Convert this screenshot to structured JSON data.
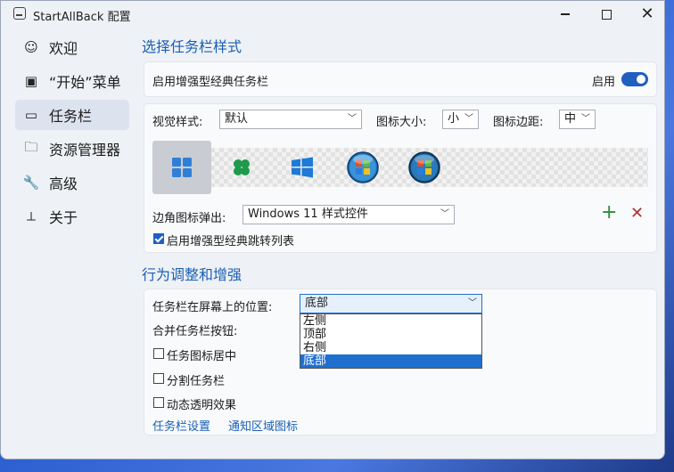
{
  "window": {
    "title": "StartAllBack 配置"
  },
  "sidebar": {
    "items": [
      {
        "label": "欢迎",
        "icon": "smile-icon"
      },
      {
        "label": "“开始”菜单",
        "icon": "start-menu-icon"
      },
      {
        "label": "任务栏",
        "icon": "taskbar-icon",
        "selected": true
      },
      {
        "label": "资源管理器",
        "icon": "folder-icon"
      },
      {
        "label": "高级",
        "icon": "wrench-icon"
      },
      {
        "label": "关于",
        "icon": "info-icon"
      }
    ]
  },
  "taskbar_style": {
    "heading": "选择任务栏样式",
    "enhanced_label": "启用增强型经典任务栏",
    "enable_label": "启用",
    "enabled": true,
    "visual_style_label": "视觉样式:",
    "visual_style_value": "默认",
    "icon_size_label": "图标大小:",
    "icon_size_value": "小",
    "icon_margin_label": "图标边距:",
    "icon_margin_value": "中",
    "start_styles": [
      "windows-11-logo-icon",
      "clover-logo-icon",
      "windows-10-logo-icon",
      "windows-7-orb-icon",
      "windows-vista-orb-icon"
    ],
    "corner_popup_label": "边角图标弹出:",
    "corner_popup_value": "Windows 11 样式控件",
    "jumplist_label": "启用增强型经典跳转列表",
    "jumplist_checked": true
  },
  "behavior": {
    "heading": "行为调整和增强",
    "position_label": "任务栏在屏幕上的位置:",
    "position_value": "底部",
    "position_options": [
      "左侧",
      "顶部",
      "右侧",
      "底部"
    ],
    "combine_label": "合并任务栏按钮:",
    "center_label": "任务图标居中",
    "split_label": "分割任务栏",
    "transparency_label": "动态透明效果",
    "link_taskbar_settings": "任务栏设置",
    "link_tray_icons": "通知区域图标"
  },
  "colors": {
    "accent": "#1f5fbf",
    "heading": "#1a5fb4",
    "add": "#2e8b3a",
    "remove": "#b03030"
  }
}
